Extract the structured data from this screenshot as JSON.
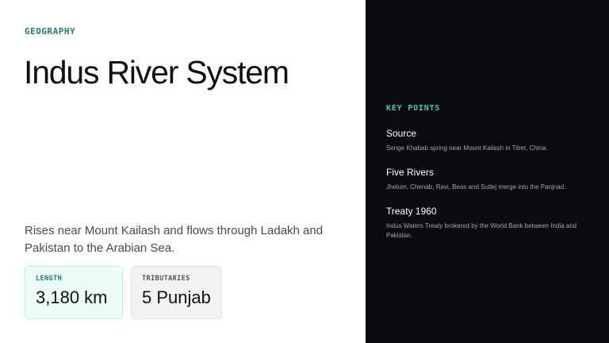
{
  "left": {
    "eyebrow": "GEOGRAPHY",
    "title": "Indus River System",
    "description": "Rises near Mount Kailash and flows through Ladakh and Pakistan to the Arabian Sea.",
    "stats": [
      {
        "label": "LENGTH",
        "value": "3,180 km"
      },
      {
        "label": "TRIBUTARIES",
        "value": "5 Punjab"
      }
    ]
  },
  "right": {
    "heading": "KEY POINTS",
    "items": [
      {
        "title": "Source",
        "text": "Senge Khabab spring near Mount Kailash in Tibet, China."
      },
      {
        "title": "Five Rivers",
        "text": "Jhelum, Chenab, Ravi, Beas and Sutlej merge into the Panjnad."
      },
      {
        "title": "Treaty 1960",
        "text": "Indus Waters Treaty brokered by the World Bank between India and Pakistan."
      }
    ]
  },
  "colors": {
    "accent": "#1a7f72",
    "accent_bright": "#2fd4b3",
    "panel_dark": "#0b0b0d"
  }
}
